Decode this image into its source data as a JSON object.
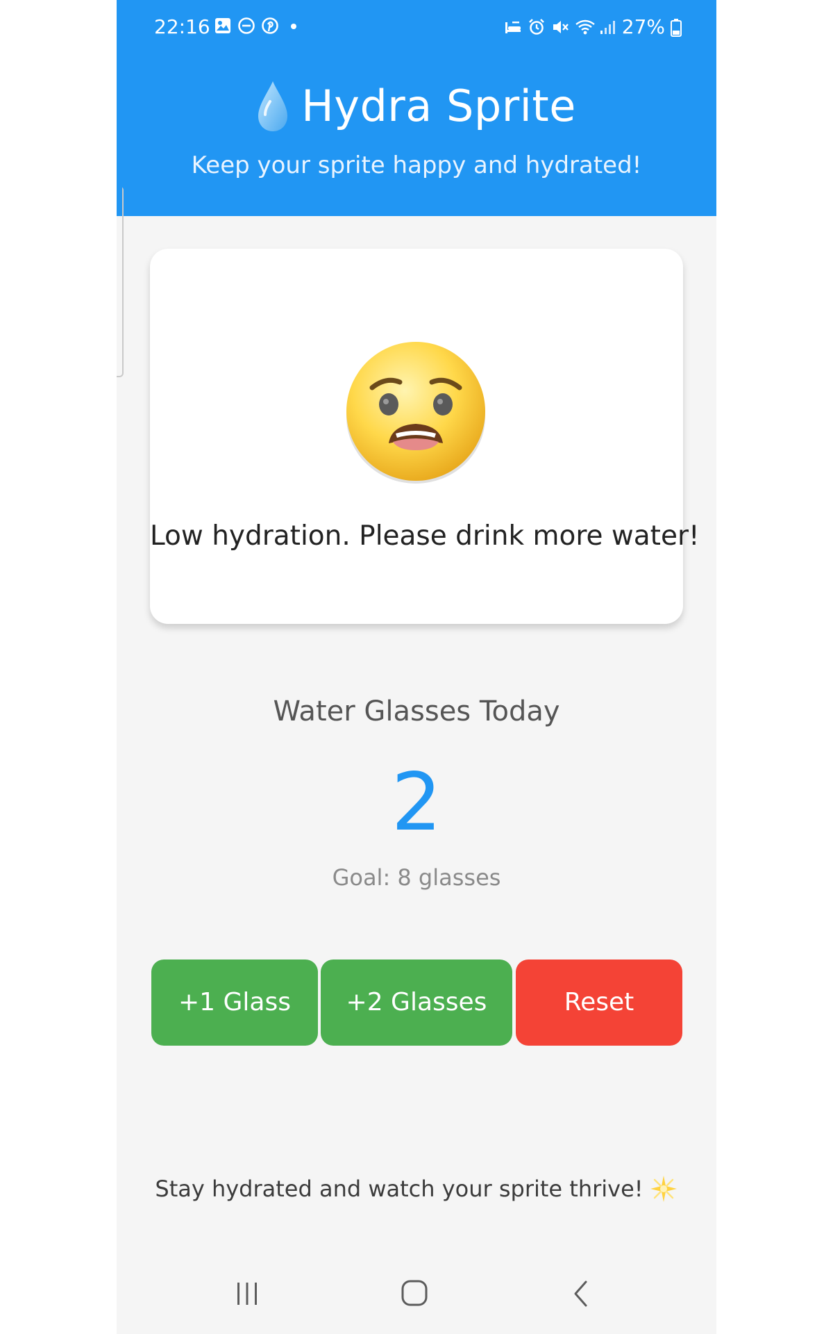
{
  "status_bar": {
    "time": "22:16",
    "battery": "27%",
    "left_icons": [
      "gallery-icon",
      "do-not-disturb-icon",
      "pinterest-icon",
      "notification-dot-icon"
    ],
    "right_icons": [
      "sleep-mode-icon",
      "alarm-icon",
      "mute-icon",
      "wifi-icon",
      "signal-icon",
      "battery-icon"
    ]
  },
  "header": {
    "icon": "water-drop-icon",
    "title": "Hydra Sprite",
    "subtitle": "Keep your sprite happy and hydrated!"
  },
  "sprite": {
    "face": "anguished-face-icon",
    "message": "Low hydration. Please drink more water!"
  },
  "stats": {
    "label": "Water Glasses Today",
    "count": "2",
    "goal": "Goal: 8 glasses"
  },
  "buttons": {
    "add_one": "+1 Glass",
    "add_two": "+2 Glasses",
    "reset": "Reset"
  },
  "footer": {
    "text": "Stay hydrated and watch your sprite thrive!",
    "icon": "sparkle-icon"
  },
  "nav": {
    "items": [
      "recents-icon",
      "home-icon",
      "back-icon"
    ]
  },
  "colors": {
    "primary": "#2196f3",
    "green": "#4caf50",
    "red": "#f44336",
    "background": "#f5f5f5"
  }
}
